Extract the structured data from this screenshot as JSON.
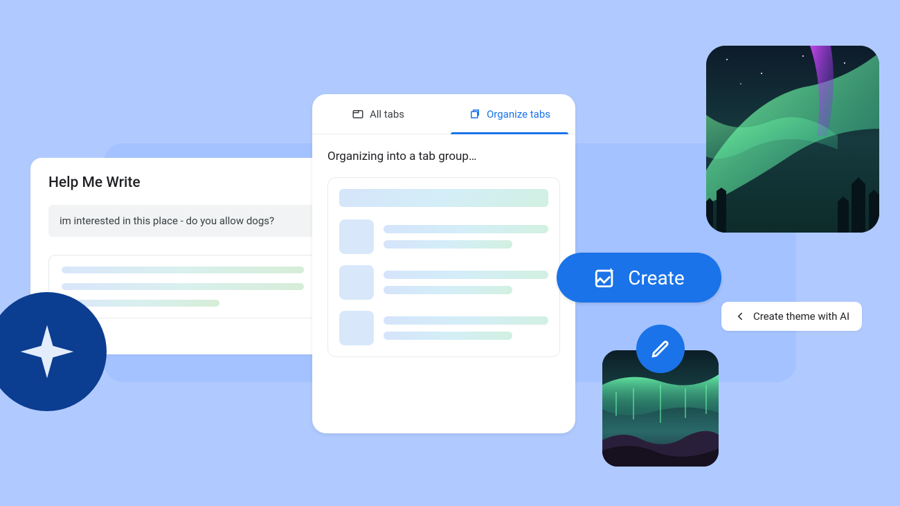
{
  "help_me_write": {
    "title": "Help Me Write",
    "input_text": "im interested in this place - do you allow dogs?"
  },
  "organize": {
    "tab_all": "All tabs",
    "tab_organize": "Organize tabs",
    "heading": "Organizing into a tab group…"
  },
  "create": {
    "button_label": "Create"
  },
  "theme": {
    "chip_label": "Create theme with AI"
  }
}
